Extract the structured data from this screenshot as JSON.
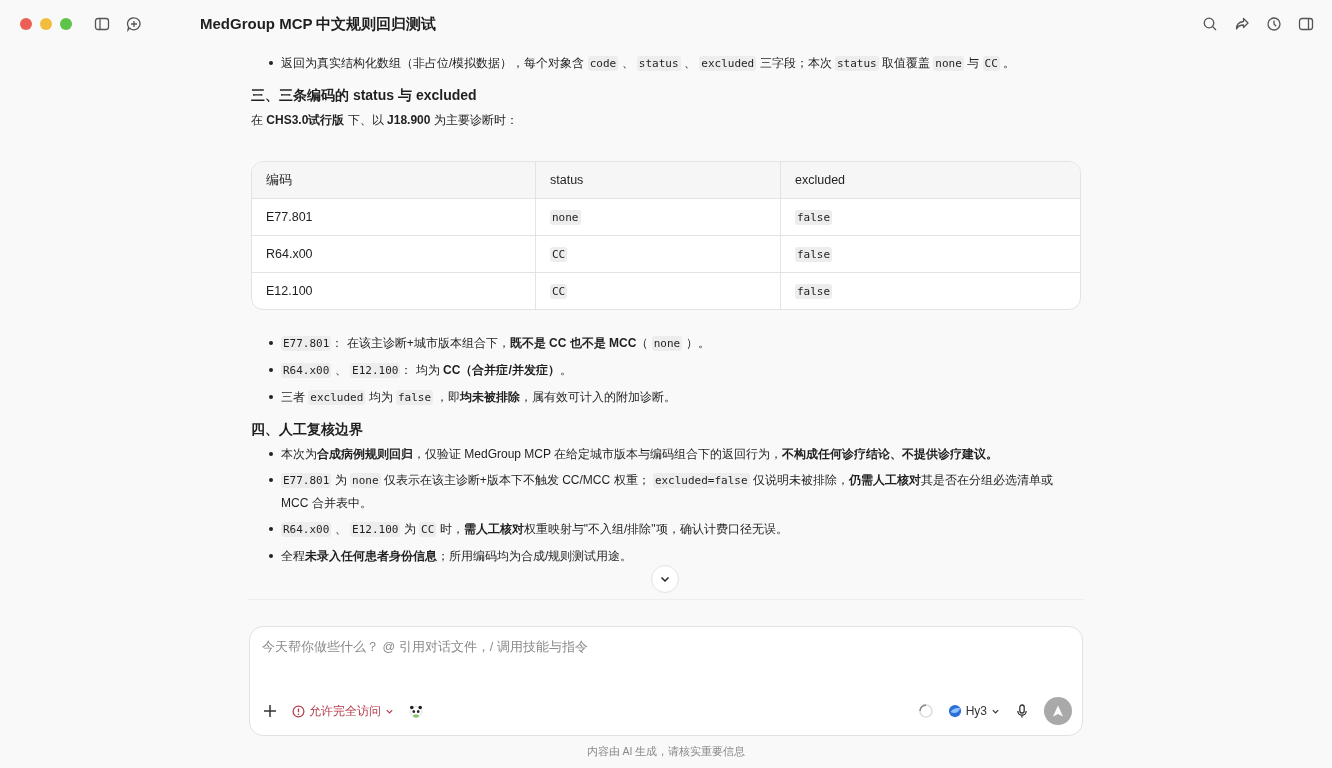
{
  "window": {
    "title": "MedGroup MCP 中文规则回归测试"
  },
  "content": [
    {
      "kind": "bullet",
      "parts": [
        {
          "kind": "text",
          "s": "返回为真实结构化数组（非占位/模拟数据），每个对象含 "
        },
        {
          "kind": "code",
          "s": "code"
        },
        {
          "kind": "text",
          "s": " 、 "
        },
        {
          "kind": "code",
          "s": "status"
        },
        {
          "kind": "text",
          "s": " 、 "
        },
        {
          "kind": "code",
          "s": "excluded"
        },
        {
          "kind": "text",
          "s": " 三字段；本次 "
        },
        {
          "kind": "code",
          "s": "status"
        },
        {
          "kind": "text",
          "s": " 取值覆盖 "
        },
        {
          "kind": "code",
          "s": "none"
        },
        {
          "kind": "text",
          "s": " 与 "
        },
        {
          "kind": "code",
          "s": "CC"
        },
        {
          "kind": "text",
          "s": " 。"
        }
      ]
    },
    {
      "kind": "heading",
      "parts": [
        {
          "kind": "text",
          "s": "三、三条编码的 status 与 excluded"
        }
      ]
    },
    {
      "kind": "para",
      "parts": [
        {
          "kind": "text",
          "s": "在 **CHS3.0试行版** 下、以 **J18.900** 为主要诊断时："
        }
      ]
    },
    {
      "kind": "table",
      "columns": [
        "编码",
        "status",
        "excluded"
      ],
      "rows": [
        [
          "E77.801",
          "none",
          "false"
        ],
        [
          "R64.x00",
          "CC",
          "false"
        ],
        [
          "E12.100",
          "CC",
          "false"
        ]
      ]
    },
    {
      "kind": "bullet",
      "parts": [
        {
          "kind": "code",
          "s": "E77.801"
        },
        {
          "kind": "text",
          "s": "： 在该主诊断+城市版本组合下，**既不是 CC 也不是 MCC**（ "
        },
        {
          "kind": "code",
          "s": "none"
        },
        {
          "kind": "text",
          "s": " ）。"
        }
      ]
    },
    {
      "kind": "bullet",
      "parts": [
        {
          "kind": "code",
          "s": "R64.x00"
        },
        {
          "kind": "text",
          "s": " 、 "
        },
        {
          "kind": "code",
          "s": "E12.100"
        },
        {
          "kind": "text",
          "s": "： 均为 **CC（合并症/并发症）**。"
        }
      ]
    },
    {
      "kind": "bullet",
      "parts": [
        {
          "kind": "text",
          "s": "三者 "
        },
        {
          "kind": "code",
          "s": "excluded"
        },
        {
          "kind": "text",
          "s": " 均为 "
        },
        {
          "kind": "code",
          "s": "false"
        },
        {
          "kind": "text",
          "s": " ，即**均未被排除**，属有效可计入的附加诊断。"
        }
      ]
    },
    {
      "kind": "heading",
      "parts": [
        {
          "kind": "text",
          "s": "四、人工复核边界"
        }
      ]
    },
    {
      "kind": "bullet",
      "parts": [
        {
          "kind": "text",
          "s": "本次为**合成病例规则回归**，仅验证 MedGroup MCP 在给定城市版本与编码组合下的返回行为，**不构成任何诊疗结论、不提供诊疗建议。**"
        }
      ]
    },
    {
      "kind": "bullet",
      "parts": [
        {
          "kind": "code",
          "s": "E77.801"
        },
        {
          "kind": "text",
          "s": " 为 "
        },
        {
          "kind": "code",
          "s": "none"
        },
        {
          "kind": "text",
          "s": " 仅表示在该主诊断+版本下不触发 CC/MCC 权重； "
        },
        {
          "kind": "code",
          "s": "excluded=false"
        },
        {
          "kind": "text",
          "s": " 仅说明未被排除，**仍需人工核对**其是否在分组必选清单或 MCC 合并表中。"
        }
      ]
    },
    {
      "kind": "bullet",
      "parts": [
        {
          "kind": "code",
          "s": "R64.x00"
        },
        {
          "kind": "text",
          "s": " 、 "
        },
        {
          "kind": "code",
          "s": "E12.100"
        },
        {
          "kind": "text",
          "s": " 为 "
        },
        {
          "kind": "code",
          "s": "CC"
        },
        {
          "kind": "text",
          "s": " 时，**需人工核对**权重映射与\"不入组/排除\"项，确认计费口径无误。"
        }
      ]
    },
    {
      "kind": "bullet",
      "parts": [
        {
          "kind": "text",
          "s": "全程**未录入任何患者身份信息**；所用编码均为合成/规则测试用途。"
        }
      ]
    }
  ],
  "composer": {
    "placeholder": "今天帮你做些什么？ @ 引用对话文件，/ 调用技能与指令",
    "access": "允许完全访问",
    "model": "Hy3"
  },
  "footer": "内容由 AI 生成，请核实重要信息"
}
